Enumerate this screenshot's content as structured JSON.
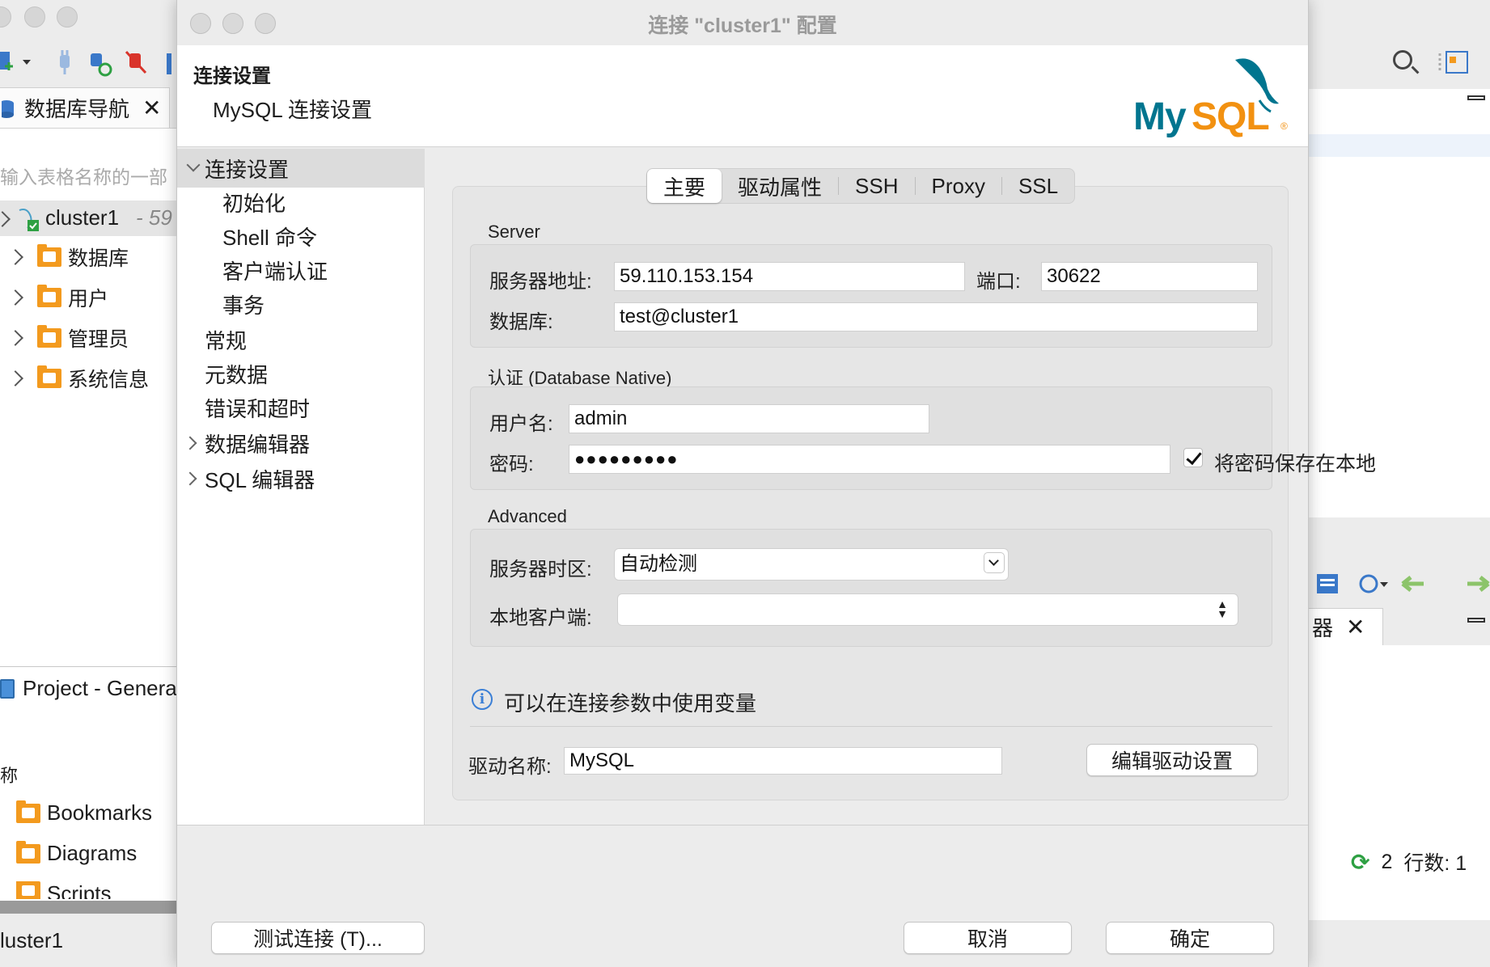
{
  "background_left": {
    "nav_tab_label": "数据库导航",
    "filter_placeholder": "输入表格名称的一部",
    "connection_name": "cluster1",
    "connection_suffix": "- 59",
    "tree_items": [
      {
        "label": "数据库",
        "icon": "database-folder-icon"
      },
      {
        "label": "用户",
        "icon": "users-folder-icon"
      },
      {
        "label": "管理员",
        "icon": "admin-folder-icon"
      },
      {
        "label": "系统信息",
        "icon": "system-info-folder-icon"
      }
    ],
    "project_tab_label": "Project - Genera",
    "project_column_label": "称",
    "project_items": [
      {
        "label": "Bookmarks",
        "icon": "bookmarks-folder-icon"
      },
      {
        "label": "Diagrams",
        "icon": "diagrams-folder-icon"
      },
      {
        "label": "Scripts",
        "icon": "scripts-folder-icon"
      }
    ],
    "status_text": "luster1"
  },
  "background_right": {
    "tab_label": "器",
    "status_count": "2",
    "row_count_label": "行数: 1"
  },
  "dialog": {
    "title": "连接 \"cluster1\" 配置",
    "header_title": "连接设置",
    "header_subtitle": "MySQL 连接设置",
    "logo_text": "MySQL",
    "logo_tm": "®",
    "sidebar": [
      {
        "label": "连接设置",
        "level": 0,
        "chevron": "down",
        "selected": true
      },
      {
        "label": "初始化",
        "level": 1
      },
      {
        "label": "Shell 命令",
        "level": 1
      },
      {
        "label": "客户端认证",
        "level": 1
      },
      {
        "label": "事务",
        "level": 1
      },
      {
        "label": "常规",
        "level": 0
      },
      {
        "label": "元数据",
        "level": 0
      },
      {
        "label": "错误和超时",
        "level": 0
      },
      {
        "label": "数据编辑器",
        "level": 0,
        "chevron": "right"
      },
      {
        "label": "SQL 编辑器",
        "level": 0,
        "chevron": "right"
      }
    ],
    "tabs": [
      "主要",
      "驱动属性",
      "SSH",
      "Proxy",
      "SSL"
    ],
    "active_tab": "主要",
    "server": {
      "group_label": "Server",
      "host_label": "服务器地址:",
      "host_value": "59.110.153.154",
      "port_label": "端口:",
      "port_value": "30622",
      "database_label": "数据库:",
      "database_value": "test@cluster1"
    },
    "auth": {
      "group_label": "认证 (Database Native)",
      "username_label": "用户名:",
      "username_value": "admin",
      "password_label": "密码:",
      "password_value": "●●●●●●●●●",
      "save_password_label": "将密码保存在本地",
      "save_password_checked": true
    },
    "advanced": {
      "group_label": "Advanced",
      "timezone_label": "服务器时区:",
      "timezone_value": "自动检测",
      "local_client_label": "本地客户端:",
      "local_client_value": ""
    },
    "info_text": "可以在连接参数中使用变量",
    "driver": {
      "label": "驱动名称:",
      "value": "MySQL",
      "edit_button": "编辑驱动设置"
    },
    "buttons": {
      "test": "测试连接 (T)...",
      "cancel": "取消",
      "ok": "确定"
    },
    "colors": {
      "accent": "#3b7fd6",
      "mysql_blue": "#00758f",
      "mysql_orange": "#f29111"
    }
  }
}
